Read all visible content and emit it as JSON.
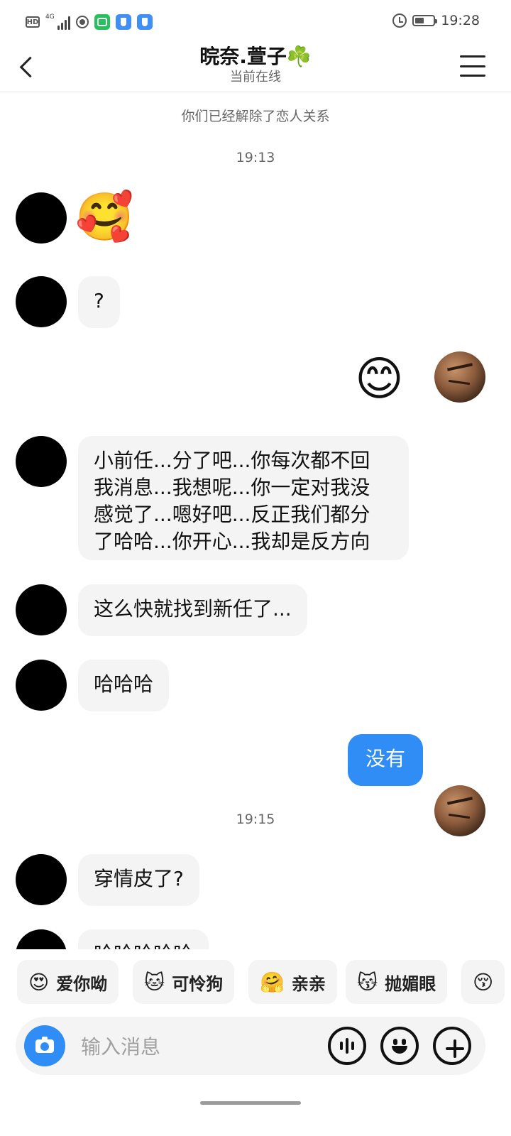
{
  "status_bar": {
    "hd_label": "HD",
    "network_label": "4G",
    "time": "19:28",
    "icons": [
      "hd-icon",
      "signal-icon",
      "screen-record-icon",
      "camera-app-icon",
      "shield-app-icon",
      "shield-app-icon",
      "alarm-icon",
      "battery-icon"
    ]
  },
  "header": {
    "title": "晥奈.萱子",
    "title_emoji": "☘️",
    "subtitle": "当前在线",
    "back_icon": "chevron-left-icon",
    "menu_icon": "hamburger-menu-icon"
  },
  "chat": {
    "system_note": "你们已经解除了恋人关系",
    "timestamps": [
      "19:13",
      "19:15"
    ],
    "messages": [
      {
        "side": "left",
        "kind": "emoji",
        "text": "🥰"
      },
      {
        "side": "left",
        "kind": "text",
        "text": "?"
      },
      {
        "side": "right",
        "kind": "emoji",
        "text": "😊"
      },
      {
        "side": "left",
        "kind": "text",
        "lines": [
          "小前任...分了吧...你每次都不回",
          "我消息...我想呢...你一定对我没",
          "感觉了...嗯好吧...反正我们都分",
          "了哈哈...你开心...我却是反方向"
        ]
      },
      {
        "side": "left",
        "kind": "text",
        "text": "这么快就找到新任了..."
      },
      {
        "side": "left",
        "kind": "text",
        "text": "哈哈哈"
      },
      {
        "side": "right",
        "kind": "text",
        "text": "没有"
      },
      {
        "side": "left",
        "kind": "text",
        "text": "穿情皮了?"
      },
      {
        "side": "left",
        "kind": "text",
        "text": "哈哈哈哈哈"
      }
    ]
  },
  "quick_replies": [
    {
      "emoji": "😍",
      "label": "爱你呦"
    },
    {
      "emoji": "🐱",
      "label": "可怜狗"
    },
    {
      "emoji": "🤗",
      "label": "亲亲"
    },
    {
      "emoji": "😽",
      "label": "抛媚眼"
    },
    {
      "emoji": "😚",
      "label": ""
    }
  ],
  "input_bar": {
    "placeholder": "输入消息",
    "camera_icon": "camera-icon",
    "voice_icon": "voice-icon",
    "emoji_icon": "emoji-icon",
    "plus_icon": "plus-icon"
  },
  "colors": {
    "accent_blue": "#2f8df5",
    "bubble_gray": "#f4f4f4",
    "clover_green": "#49b14a"
  }
}
